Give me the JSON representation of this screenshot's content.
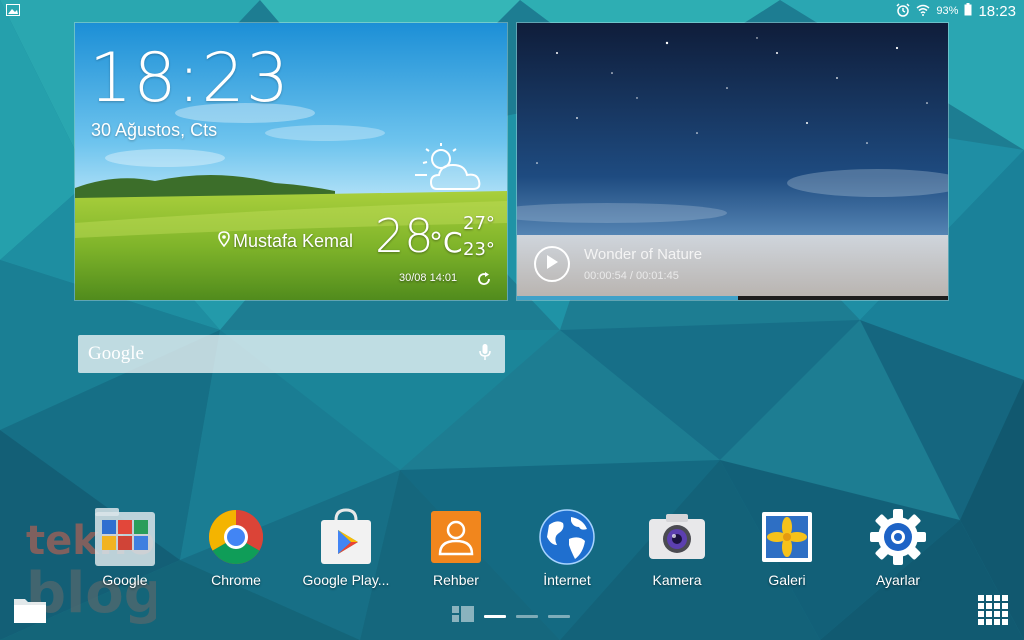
{
  "status_bar": {
    "battery_percent": "93%",
    "time": "18:23"
  },
  "clock_widget": {
    "time": "18:23",
    "date": "30 Ağustos, Cts",
    "location": "Mustafa Kemal",
    "temperature": "28",
    "unit": "°C",
    "high": "27°",
    "low": "23°",
    "updated": "30/08 14:01",
    "condition_icon": "partly-cloudy-icon"
  },
  "video_widget": {
    "title": "Wonder of Nature",
    "time": "00:00:54 / 00:01:45",
    "progress": 0.51
  },
  "search": {
    "logo": "Google"
  },
  "apps": [
    {
      "id": "google",
      "label": "Google",
      "icon": "google-folder-icon"
    },
    {
      "id": "chrome",
      "label": "Chrome",
      "icon": "chrome-icon"
    },
    {
      "id": "play",
      "label": "Google Play...",
      "icon": "play-store-icon"
    },
    {
      "id": "rehber",
      "label": "Rehber",
      "icon": "contacts-icon"
    },
    {
      "id": "internet",
      "label": "İnternet",
      "icon": "globe-icon"
    },
    {
      "id": "kamera",
      "label": "Kamera",
      "icon": "camera-icon"
    },
    {
      "id": "galeri",
      "label": "Galeri",
      "icon": "gallery-icon"
    },
    {
      "id": "ayarlar",
      "label": "Ayarlar",
      "icon": "settings-gear-icon"
    }
  ],
  "watermark": {
    "line1": "tekno",
    "line2": "blog"
  },
  "page_indicator": {
    "pages": 3,
    "active": 0
  },
  "colors": {
    "accent": "#3fa1c8",
    "wallpaper": "#1f7f95"
  }
}
